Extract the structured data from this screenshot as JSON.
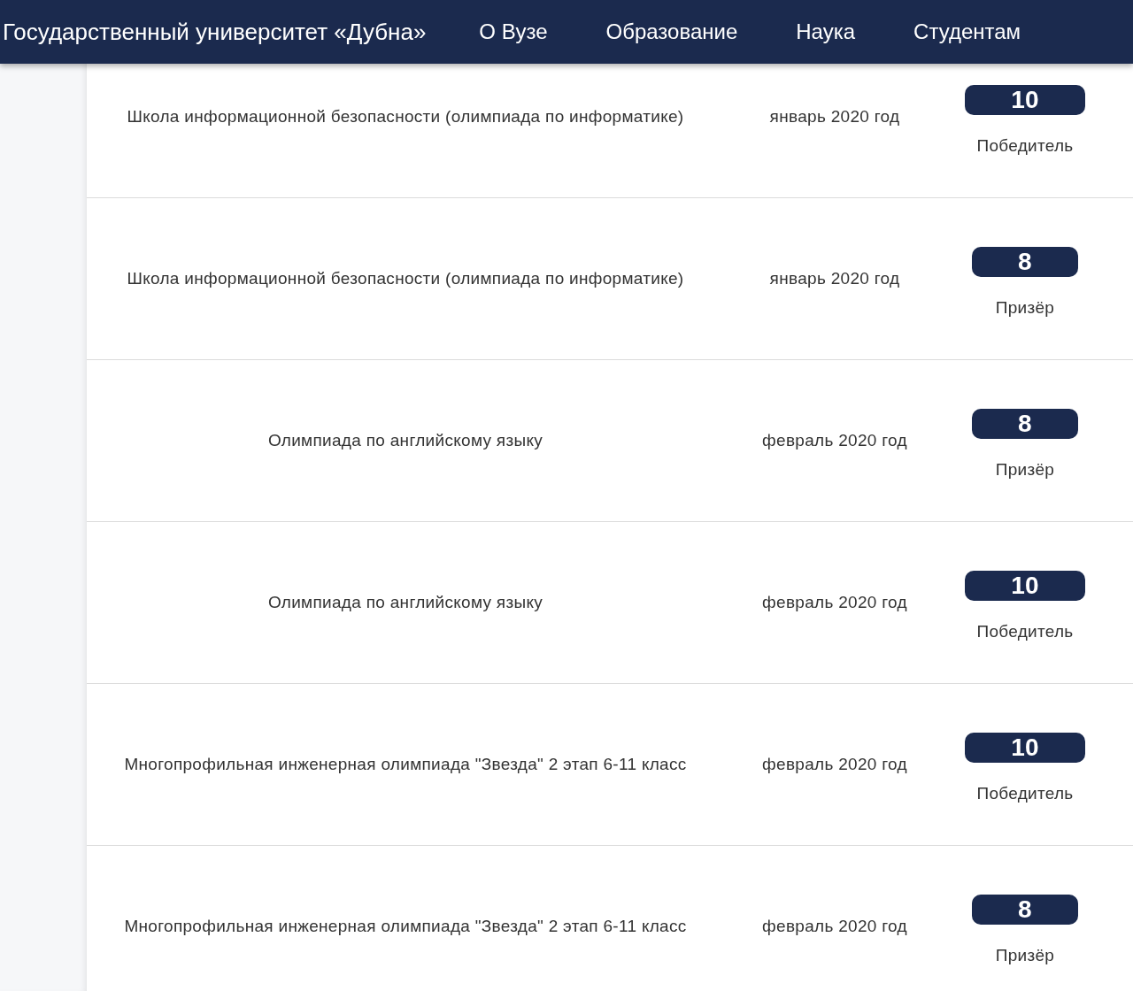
{
  "header": {
    "title": "Государственный университет «Дубна»",
    "nav": [
      {
        "label": "О Вузе"
      },
      {
        "label": "Образование"
      },
      {
        "label": "Наука"
      },
      {
        "label": "Студентам"
      }
    ]
  },
  "rows": [
    {
      "name": "Школа информационной безопасности (олимпиада по информатике)",
      "date": "январь 2020 год",
      "grade": "10",
      "result": "Победитель"
    },
    {
      "name": "Школа информационной безопасности (олимпиада по информатике)",
      "date": "январь 2020 год",
      "grade": "8",
      "result": "Призёр"
    },
    {
      "name": "Олимпиада по английскому языку",
      "date": "февраль 2020 год",
      "grade": "8",
      "result": "Призёр"
    },
    {
      "name": "Олимпиада по английскому языку",
      "date": "февраль 2020 год",
      "grade": "10",
      "result": "Победитель"
    },
    {
      "name": "Многопрофильная инженерная олимпиада \"Звезда\" 2 этап 6-11 класс",
      "date": "февраль 2020 год",
      "grade": "10",
      "result": "Победитель"
    },
    {
      "name": "Многопрофильная инженерная олимпиада \"Звезда\" 2 этап 6-11 класс",
      "date": "февраль 2020 год",
      "grade": "8",
      "result": "Призёр"
    }
  ]
}
